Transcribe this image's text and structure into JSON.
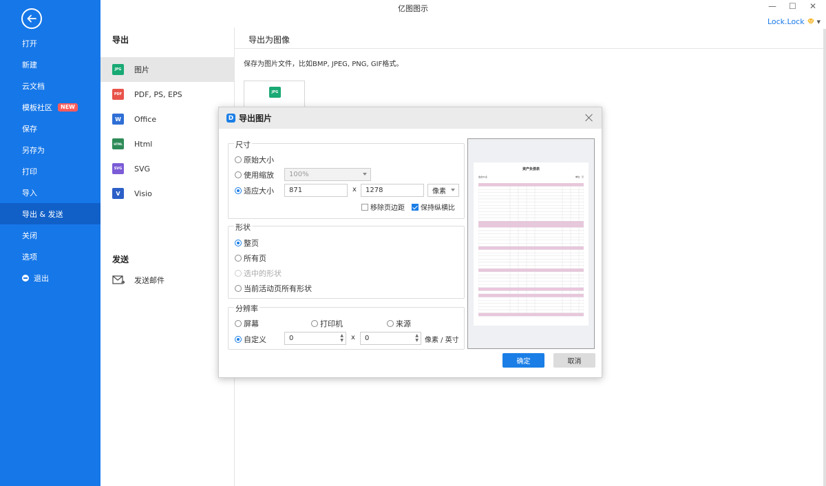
{
  "app": {
    "title": "亿图图示"
  },
  "window_controls": {
    "minimize": "—",
    "maximize": "☐",
    "close": "✕"
  },
  "user": {
    "name": "Lock.Lock"
  },
  "sidebar": {
    "items": [
      {
        "label": "打开"
      },
      {
        "label": "新建"
      },
      {
        "label": "云文档"
      },
      {
        "label": "模板社区",
        "badge": "NEW"
      },
      {
        "label": "保存"
      },
      {
        "label": "另存为"
      },
      {
        "label": "打印"
      },
      {
        "label": "导入"
      },
      {
        "label": "导出 & 发送",
        "active": true
      },
      {
        "label": "关闭"
      },
      {
        "label": "选项"
      },
      {
        "label": "退出"
      }
    ]
  },
  "export_panel": {
    "title": "导出",
    "formats": [
      {
        "label": "图片",
        "icon": "JPG",
        "color": "#19a974",
        "active": true
      },
      {
        "label": "PDF, PS, EPS",
        "icon": "PDF",
        "color": "#e8534a"
      },
      {
        "label": "Office",
        "icon": "W",
        "color": "#2f6fd6"
      },
      {
        "label": "Html",
        "icon": "HTML",
        "color": "#2e8b57"
      },
      {
        "label": "SVG",
        "icon": "SVG",
        "color": "#7b5cd6"
      },
      {
        "label": "Visio",
        "icon": "V",
        "color": "#2c5fc7"
      }
    ],
    "send_title": "发送",
    "send_items": [
      {
        "label": "发送邮件"
      }
    ]
  },
  "content": {
    "title": "导出为图像",
    "description": "保存为图片文件，比如BMP, JPEG, PNG, GIF格式。",
    "tile_icon": "JPG"
  },
  "dialog": {
    "title": "导出图片",
    "size": {
      "legend": "尺寸",
      "original": "原始大小",
      "use_zoom": "使用缩放",
      "zoom_value": "100%",
      "fit": "适应大小",
      "width": "871",
      "height": "1278",
      "x": "x",
      "unit": "像素",
      "remove_margin": "移除页边距",
      "keep_ratio": "保持纵横比"
    },
    "shape": {
      "legend": "形状",
      "whole_page": "整页",
      "all_pages": "所有页",
      "selected": "选中的形状",
      "current_all": "当前活动页所有形状"
    },
    "resolution": {
      "legend": "分辨率",
      "screen": "屏幕",
      "printer": "打印机",
      "source": "来源",
      "custom": "自定义",
      "dpi_x": "0",
      "dpi_y": "0",
      "x": "x",
      "unit": "像素 / 英寸"
    },
    "preview": {
      "title": "资产负债表",
      "company": "会企01表",
      "unit": "单位：元"
    },
    "ok": "确定",
    "cancel": "取消"
  }
}
